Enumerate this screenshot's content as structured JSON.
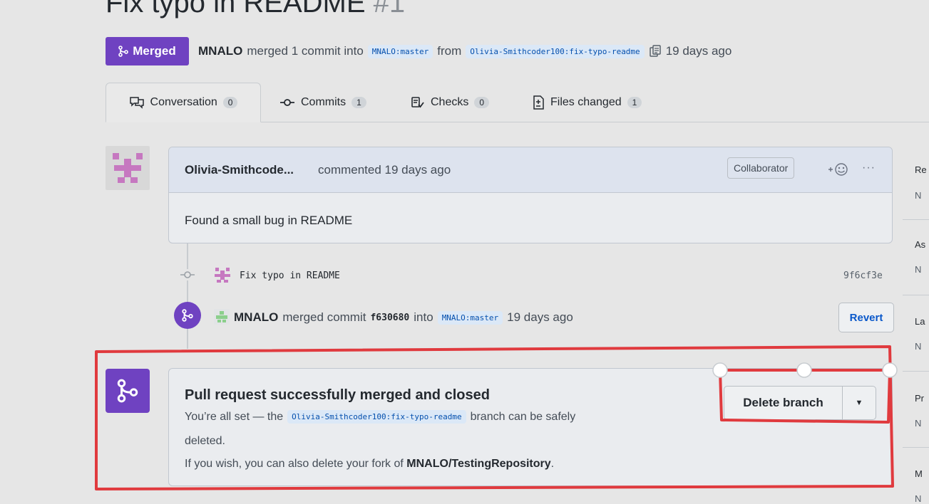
{
  "pr": {
    "title": "Fix typo in README",
    "number": "#1",
    "status_label": "Merged",
    "merger": "MNALO",
    "merged_text": "merged 1 commit into",
    "base_branch": "MNALO:master",
    "from_text": "from",
    "head_branch": "Olivia-Smithcoder100:fix-typo-readme",
    "time_ago": "19 days ago"
  },
  "tabs": [
    {
      "label": "Conversation",
      "count": "0"
    },
    {
      "label": "Commits",
      "count": "1"
    },
    {
      "label": "Checks",
      "count": "0"
    },
    {
      "label": "Files changed",
      "count": "1"
    }
  ],
  "comment": {
    "author": "Olivia-Smithcode...",
    "action": "commented 19 days ago",
    "role_badge": "Collaborator",
    "body": "Found a small bug in README"
  },
  "commit": {
    "message": "Fix typo in README",
    "sha": "9f6cf3e"
  },
  "merge_event": {
    "actor": "MNALO",
    "text": "merged commit",
    "commit_sha": "f630680",
    "into_text": "into",
    "branch": "MNALO:master",
    "time_ago": "19 days ago",
    "revert_label": "Revert"
  },
  "merged_box": {
    "heading": "Pull request successfully merged and closed",
    "line1_prefix": "You’re all set — the",
    "branch": "Olivia-Smithcoder100:fix-typo-readme",
    "line1_suffix": "branch can be safely",
    "line2": "deleted.",
    "line3_prefix": "If you wish, you can also delete your fork of",
    "repo": "MNALO/TestingRepository",
    "line3_suffix": ".",
    "delete_label": "Delete branch"
  },
  "sidebar": [
    {
      "label": "Re",
      "sub": "N"
    },
    {
      "label": "As",
      "sub": "N"
    },
    {
      "label": "La",
      "sub": "N"
    },
    {
      "label": "Pr",
      "sub": "N"
    },
    {
      "label": "M",
      "sub": "N"
    }
  ],
  "colors": {
    "merged_purple": "#6f42c1",
    "annotation_red": "#e03a3e",
    "link_blue": "#0a58ca"
  }
}
